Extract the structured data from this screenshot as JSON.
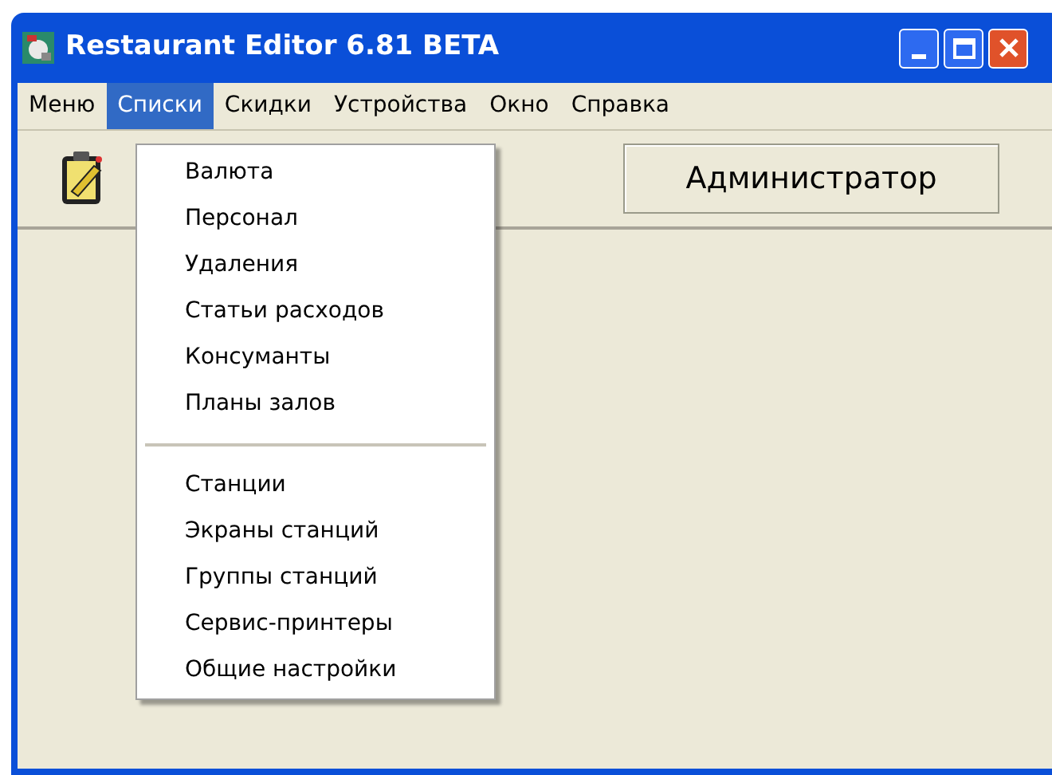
{
  "window": {
    "title": "Restaurant Editor 6.81 BETA"
  },
  "menu_bar": [
    {
      "label": "Меню",
      "selected": false
    },
    {
      "label": "Списки",
      "selected": true
    },
    {
      "label": "Скидки",
      "selected": false
    },
    {
      "label": "Устройства",
      "selected": false
    },
    {
      "label": "Окно",
      "selected": false
    },
    {
      "label": "Справка",
      "selected": false
    }
  ],
  "toolbar": {
    "user_button": "Администратор"
  },
  "dropdown": [
    {
      "kind": "item",
      "label": "Валюта"
    },
    {
      "kind": "item",
      "label": "Персонал"
    },
    {
      "kind": "item",
      "label": "Удаления"
    },
    {
      "kind": "item",
      "label": "Статьи расходов"
    },
    {
      "kind": "item",
      "label": "Консуманты"
    },
    {
      "kind": "item",
      "label": "Планы залов"
    },
    {
      "kind": "separator"
    },
    {
      "kind": "item",
      "label": "Станции"
    },
    {
      "kind": "item",
      "label": "Экраны станций"
    },
    {
      "kind": "item",
      "label": "Группы станций"
    },
    {
      "kind": "item",
      "label": "Сервис-принтеры"
    },
    {
      "kind": "item",
      "label": "Общие настройки"
    }
  ]
}
